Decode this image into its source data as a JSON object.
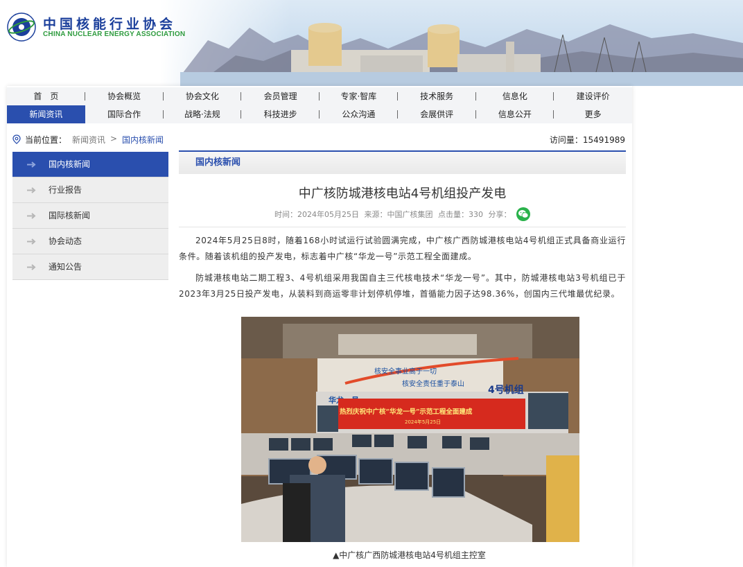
{
  "header": {
    "org_name_cn": "中国核能行业协会",
    "org_name_en": "CHINA NUCLEAR ENERGY ASSOCIATION"
  },
  "nav": {
    "row1": [
      "首　页",
      "协会概览",
      "协会文化",
      "会员管理",
      "专家·智库",
      "技术服务",
      "信息化",
      "建设评价"
    ],
    "row2": [
      "新闻资讯",
      "国际合作",
      "战略·法规",
      "科技进步",
      "公众沟通",
      "会展供评",
      "信息公开",
      "更多"
    ],
    "active": "新闻资讯"
  },
  "breadcrumb": {
    "label": "当前位置：",
    "items": [
      "新闻资讯",
      "国内核新闻"
    ],
    "separator": ">",
    "visits": "访问量：15491989"
  },
  "sidebar": {
    "items": [
      {
        "label": "国内核新闻",
        "active": true
      },
      {
        "label": "行业报告",
        "active": false
      },
      {
        "label": "国际核新闻",
        "active": false
      },
      {
        "label": "协会动态",
        "active": false
      },
      {
        "label": "通知公告",
        "active": false
      }
    ]
  },
  "article": {
    "section": "国内核新闻",
    "title": "中广核防城港核电站4号机组投产发电",
    "meta": {
      "time": "时间：2024年05月25日",
      "source": "来源：中国广核集团",
      "clicks": "点击量：330",
      "share": "分享："
    },
    "paragraphs": [
      "2024年5月25日8时，随着168小时试运行试验圆满完成，中广核广西防城港核电站4号机组正式具备商业运行条件。随着该机组的投产发电，标志着中广核“华龙一号”示范工程全面建成。",
      "防城港核电站二期工程3、4号机组采用我国自主三代核电技术“华龙一号”。其中，防城港核电站3号机组已于2023年3月25日投产发电，从装料到商运零非计划停机停堆，首循能力因子达98.36%，创国内三代堆最优纪录。"
    ],
    "photo": {
      "slogan_1": "核安全事业高于一切",
      "slogan_2": "核安全责任重于泰山",
      "wall_left": "华龙一号",
      "wall_right": "4号机组",
      "banner_text": "热烈庆祝中广核“华龙一号”示范工程全面建成",
      "banner_date": "2024年5月25日"
    },
    "caption": "▲中广核广西防城港核电站4号机组主控室"
  },
  "colors": {
    "primary": "#2a4fae",
    "wechat": "#2ab24b"
  }
}
